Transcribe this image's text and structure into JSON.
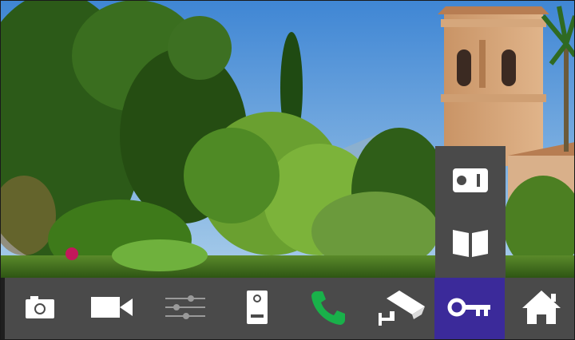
{
  "toolbar": {
    "active_index": 7,
    "active_color": "#3b2a9a",
    "background_color": "#4a4a4a",
    "buttons": [
      {
        "icon": "camera-icon",
        "active": false
      },
      {
        "icon": "video-camera-icon",
        "active": false
      },
      {
        "icon": "settings-sliders-icon",
        "active": false
      },
      {
        "icon": "door-panel-icon",
        "active": false
      },
      {
        "icon": "phone-icon",
        "active": false,
        "color": "#19b14a"
      },
      {
        "icon": "cctv-camera-icon",
        "active": false
      },
      {
        "icon": "key-icon",
        "active": true
      },
      {
        "icon": "home-icon",
        "active": false
      }
    ]
  },
  "side_menu": {
    "items": [
      {
        "icon": "intercom-unit-icon"
      },
      {
        "icon": "address-book-icon"
      }
    ]
  },
  "camera_view": {
    "scene": "garden-with-brick-tower",
    "sky_color": "#4a8fd6",
    "foliage_color": "#3f7a1e"
  }
}
